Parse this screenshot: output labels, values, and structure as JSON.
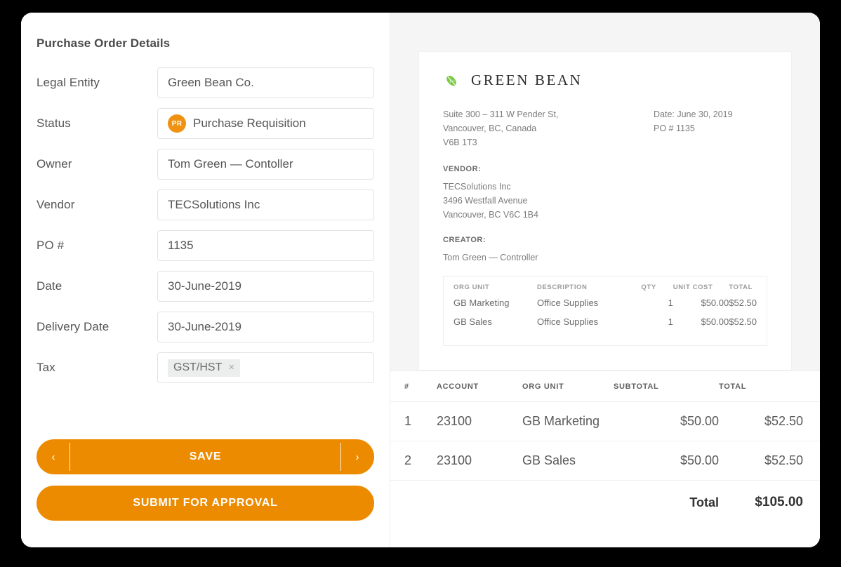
{
  "left_panel": {
    "title": "Purchase Order Details",
    "fields": [
      {
        "label": "Legal Entity",
        "value": "Green Bean Co."
      },
      {
        "label": "Status",
        "value": "Purchase Requisition",
        "badge": "PR"
      },
      {
        "label": "Owner",
        "value": "Tom Green — Contoller"
      },
      {
        "label": "Vendor",
        "value": "TECSolutions Inc"
      },
      {
        "label": "PO #",
        "value": "1135"
      },
      {
        "label": "Date",
        "value": "30-June-2019"
      },
      {
        "label": "Delivery Date",
        "value": "30-June-2019"
      },
      {
        "label": "Tax",
        "chip": "GST/HST",
        "chip_remove": "×"
      }
    ],
    "buttons": {
      "prev": "‹",
      "save": "SAVE",
      "next": "›",
      "submit": "SUBMIT FOR APPROVAL"
    }
  },
  "document": {
    "brand_name": "GREEN BEAN",
    "company_address": [
      "Suite 300 – 311 W Pender St,",
      "Vancouver, BC, Canada",
      "V6B 1T3"
    ],
    "meta": [
      "Date: June 30, 2019",
      "PO # 1135"
    ],
    "vendor_label": "VENDOR:",
    "vendor_address": [
      "TECSolutions Inc",
      "3496 Westfall Avenue",
      "Vancouver, BC V6C 1B4"
    ],
    "creator_label": "CREATOR:",
    "creator_name": "Tom Green — Controller",
    "items_table": {
      "headers": [
        "ORG UNIT",
        "DESCRIPTION",
        "QTY",
        "UNIT COST",
        "TOTAL"
      ],
      "rows": [
        [
          "GB Marketing",
          "Office Supplies",
          "1",
          "$50.00",
          "$52.50"
        ],
        [
          "GB Sales",
          "Office Supplies",
          "1",
          "$50.00",
          "$52.50"
        ]
      ]
    }
  },
  "summary_table": {
    "headers": [
      "#",
      "ACCOUNT",
      "ORG UNIT",
      "SUBTOTAL",
      "TOTAL"
    ],
    "rows": [
      {
        "num": "1",
        "account": "23100",
        "org_unit": "GB Marketing",
        "subtotal": "$50.00",
        "total": "$52.50"
      },
      {
        "num": "2",
        "account": "23100",
        "org_unit": "GB Sales",
        "subtotal": "$50.00",
        "total": "$52.50"
      }
    ],
    "total_label": "Total",
    "total_value": "$105.00"
  },
  "colors": {
    "accent_orange": "#ed8b00",
    "badge_orange": "#ef9111",
    "leaf_green": "#7ac943"
  }
}
